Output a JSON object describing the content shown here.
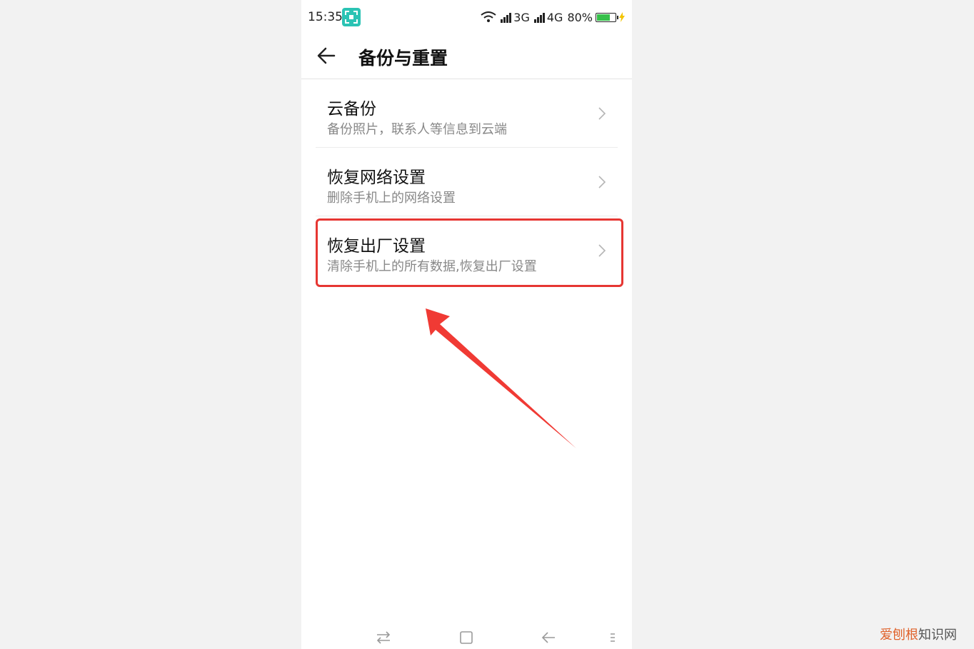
{
  "status_bar": {
    "time": "15:35",
    "network_3g": "3G",
    "network_4g": "4G",
    "battery": "80%",
    "battery_level": 0.8,
    "scan_icon": "scan-icon"
  },
  "header": {
    "title": "备份与重置",
    "back_icon": "arrow-left-icon"
  },
  "items": [
    {
      "label": "云备份",
      "desc": "备份照片，联系人等信息到云端"
    },
    {
      "label": "恢复网络设置",
      "desc": "删除手机上的网络设置"
    },
    {
      "label": "恢复出厂设置",
      "desc": "清除手机上的所有数据,恢复出厂设置"
    }
  ],
  "annotation": {
    "highlight_color": "#e63632",
    "arrow_color": "#f03a34",
    "highlighted_item": 2
  },
  "nav_bar": {
    "icons": [
      "switch-apps-icon",
      "home-square-icon",
      "back-arrow-icon",
      "menu-icon"
    ]
  },
  "watermark": {
    "part1": "爱刨根",
    "part2": "知识网"
  }
}
